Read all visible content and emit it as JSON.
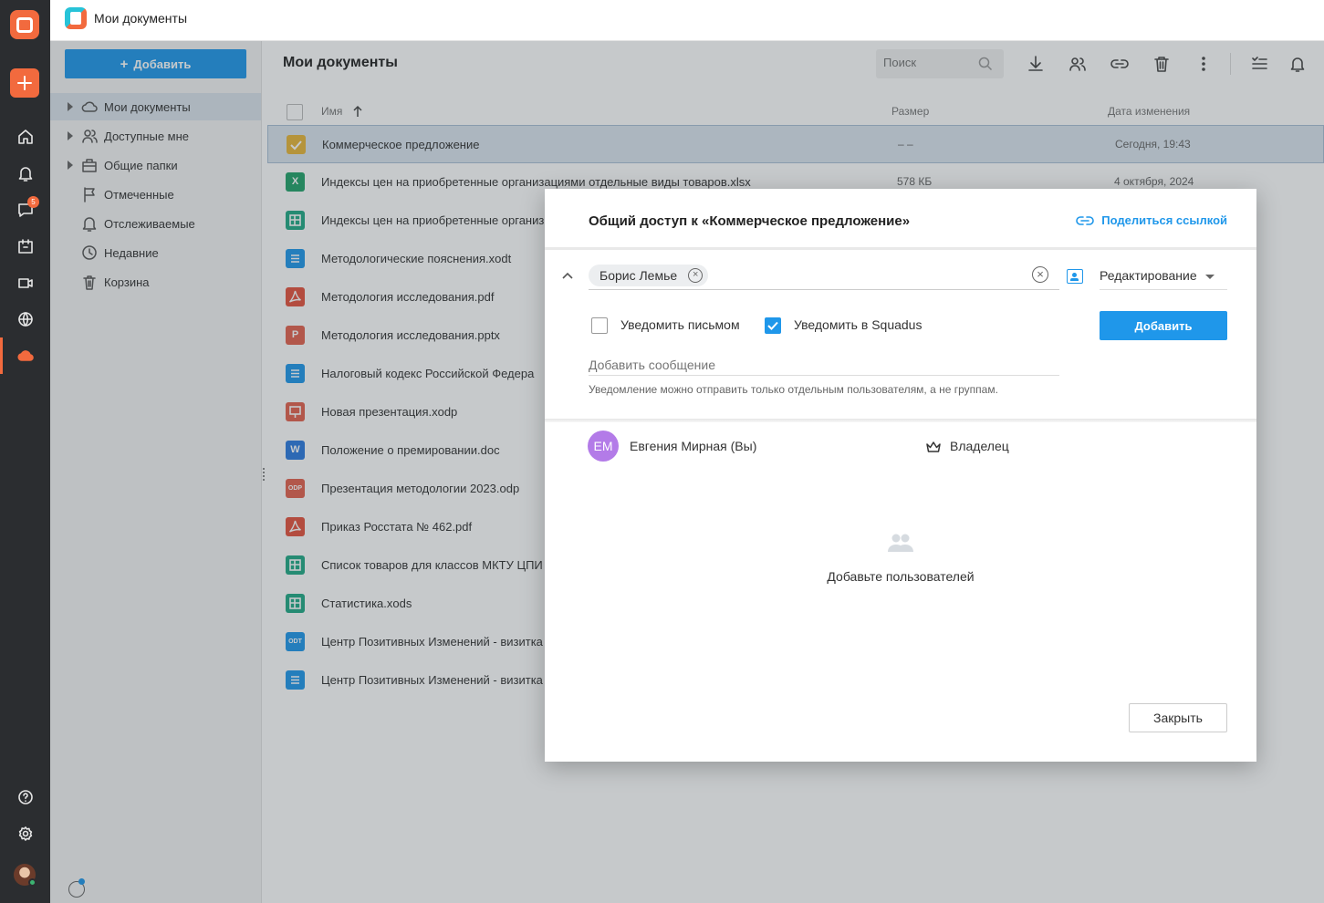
{
  "app": {
    "title": "Мои документы"
  },
  "rail": {
    "messages_badge": "5"
  },
  "sidebar": {
    "add_button": "Добавить",
    "items": [
      {
        "label": "Мои документы",
        "icon": "cloud-icon",
        "expandable": true,
        "active": true
      },
      {
        "label": "Доступные мне",
        "icon": "people-icon",
        "expandable": true,
        "active": false
      },
      {
        "label": "Общие папки",
        "icon": "briefcase-icon",
        "expandable": true,
        "active": false
      },
      {
        "label": "Отмеченные",
        "icon": "flag-icon",
        "expandable": false,
        "active": false
      },
      {
        "label": "Отслеживаемые",
        "icon": "bell-icon",
        "expandable": false,
        "active": false
      },
      {
        "label": "Недавние",
        "icon": "clock-icon",
        "expandable": false,
        "active": false
      },
      {
        "label": "Корзина",
        "icon": "trash-icon",
        "expandable": false,
        "active": false
      }
    ]
  },
  "main": {
    "title": "Мои документы",
    "search_placeholder": "Поиск",
    "columns": {
      "name": "Имя",
      "size": "Размер",
      "date": "Дата изменения"
    },
    "files": [
      {
        "name": "Коммерческое предложение",
        "size": "– –",
        "date": "Сегодня, 19:43",
        "type": "folder-check",
        "color": "#e8b63a",
        "selected": true
      },
      {
        "name": "Индексы цен на приобретенные организациями отдельные виды товаров.xlsx",
        "size": "578 КБ",
        "date": "4 октября, 2024",
        "type": "X",
        "color": "#22a36a",
        "selected": false
      },
      {
        "name": "Индексы цен на приобретенные организ",
        "size": "",
        "date": "",
        "type": "sheet",
        "color": "#21a985",
        "selected": false
      },
      {
        "name": "Методологические пояснения.xodt",
        "size": "",
        "date": "",
        "type": "doc",
        "color": "#1f97ea",
        "selected": false
      },
      {
        "name": "Методология исследования.pdf",
        "size": "",
        "date": "",
        "type": "pdf",
        "color": "#e5533d",
        "selected": false
      },
      {
        "name": "Методология исследования.pptx",
        "size": "",
        "date": "",
        "type": "P",
        "color": "#e3624e",
        "selected": false
      },
      {
        "name": "Налоговый кодекс Российской Федера",
        "size": "",
        "date": "",
        "type": "doc",
        "color": "#1f97ea",
        "selected": false
      },
      {
        "name": "Новая презентация.xodp",
        "size": "",
        "date": "",
        "type": "pres",
        "color": "#e3624e",
        "selected": false
      },
      {
        "name": "Положение о премировании.doc",
        "size": "",
        "date": "",
        "type": "W",
        "color": "#2b7ae0",
        "selected": false
      },
      {
        "name": "Презентация методологии 2023.odp",
        "size": "",
        "date": "",
        "type": "ODP",
        "color": "#e3624e",
        "selected": false
      },
      {
        "name": "Приказ Росстата № 462.pdf",
        "size": "",
        "date": "",
        "type": "pdf",
        "color": "#e5533d",
        "selected": false
      },
      {
        "name": "Список товаров для классов МКТУ ЦПИ",
        "size": "",
        "date": "",
        "type": "sheet",
        "color": "#21a985",
        "selected": false
      },
      {
        "name": "Статистика.xods",
        "size": "",
        "date": "",
        "type": "sheet",
        "color": "#21a985",
        "selected": false
      },
      {
        "name": "Центр Позитивных Изменений - визитка",
        "size": "",
        "date": "",
        "type": "ODT",
        "color": "#1f97ea",
        "selected": false
      },
      {
        "name": "Центр Позитивных Изменений - визитка",
        "size": "",
        "date": "",
        "type": "doc",
        "color": "#1f97ea",
        "selected": false
      }
    ]
  },
  "modal": {
    "title": "Общий доступ к «Коммерческое предложение»",
    "share_link": "Поделиться ссылкой",
    "recipient_tag": "Борис Лемье",
    "permission": "Редактирование",
    "notify_email_label": "Уведомить письмом",
    "notify_email_checked": false,
    "notify_app_label": "Уведомить в Squadus",
    "notify_app_checked": true,
    "add_button": "Добавить",
    "message_placeholder": "Добавить сообщение",
    "hint": "Уведомление можно отправить только отдельным пользователям, а не группам.",
    "owner": {
      "initials": "ЕМ",
      "name": "Евгения Мирная (Вы)",
      "role": "Владелец",
      "avatar_color": "#b37be8"
    },
    "empty_text": "Добавьте пользователей",
    "close_button": "Закрыть"
  },
  "colors": {
    "accent": "#1f97ea",
    "brand": "#f26a3e",
    "rail": "#2b2d30"
  }
}
